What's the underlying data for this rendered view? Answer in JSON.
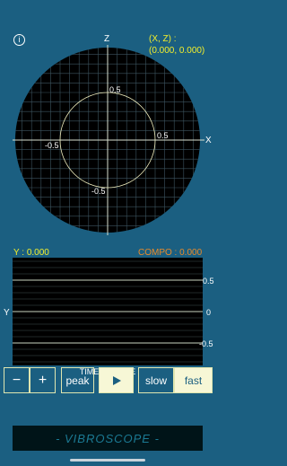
{
  "scope": {
    "info_icon": "info-icon",
    "z_axis": "Z",
    "x_axis": "X",
    "coord_label": "(X, Z) :",
    "coord_value": "(0.000, 0.000)",
    "tick_pos_vertical": "0.5",
    "tick_neg_vertical": "-0.5",
    "tick_pos_horizontal": "0.5",
    "tick_neg_horizontal": "-0.5"
  },
  "trace": {
    "y_readout": "Y : 0.000",
    "compo_readout": "COMPO : 0.000",
    "y_axis": "Y",
    "tick_top": "0.5",
    "tick_mid": "0",
    "tick_bottom": "-0.5",
    "footer_label": "TIME COURSE"
  },
  "controls": {
    "minus_label": "−",
    "plus_label": "+",
    "peak_label": "peak",
    "play_icon": "play-icon",
    "slow_label": "slow",
    "fast_label": "fast"
  },
  "banner": {
    "label": "- VIBROSCOPE -"
  },
  "colors": {
    "background": "#1b5f81",
    "accent_yellow": "#f2ee2c",
    "accent_orange": "#e88a2a",
    "button_active": "#f7f7d6"
  }
}
